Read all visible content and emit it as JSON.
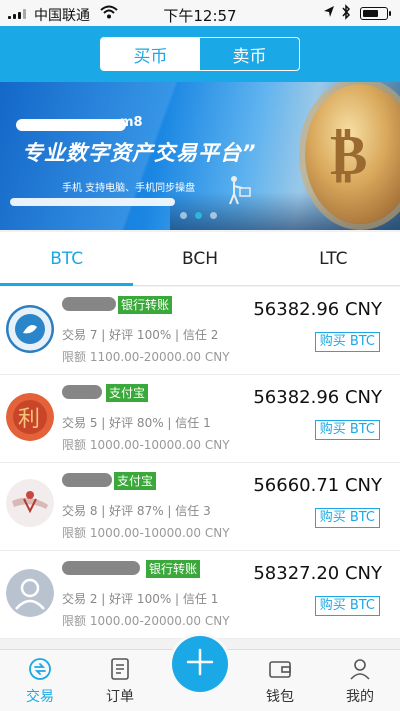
{
  "status_bar": {
    "carrier": "中国联通",
    "time": "下午12:57"
  },
  "header": {
    "segments": [
      "买币",
      "卖币"
    ],
    "active_segment": "买币"
  },
  "banner": {
    "brand_tail": "m8",
    "headline": "专业数字资产交易平台”",
    "subline": "手机  支持电脑、手机同步操盘"
  },
  "coin_tabs": [
    "BTC",
    "BCH",
    "LTC"
  ],
  "active_coin": "BTC",
  "listings": [
    {
      "payment": "银行转账",
      "stats": "交易 7 | 好评 100% | 信任 2",
      "limit": "限额 1100.00-20000.00 CNY",
      "price": "56382.96 CNY",
      "buy_label": "购买 BTC"
    },
    {
      "payment": "支付宝",
      "stats": "交易 5 | 好评 80% | 信任 1",
      "limit": "限额 1000.00-10000.00 CNY",
      "price": "56382.96 CNY",
      "buy_label": "购买 BTC"
    },
    {
      "payment": "支付宝",
      "stats": "交易 8 | 好评 87% | 信任 3",
      "limit": "限额 1000.00-10000.00 CNY",
      "price": "56660.71 CNY",
      "buy_label": "购买 BTC"
    },
    {
      "payment": "银行转账",
      "stats": "交易 2 | 好评 100% | 信任 1",
      "limit": "限额 1000.00-20000.00 CNY",
      "price": "58327.20 CNY",
      "buy_label": "购买 BTC"
    }
  ],
  "tab_bar": {
    "items": [
      {
        "label": "交易",
        "icon": "exchange-icon"
      },
      {
        "label": "订单",
        "icon": "order-icon"
      },
      {
        "label": "钱包",
        "icon": "wallet-icon"
      },
      {
        "label": "我的",
        "icon": "profile-icon"
      }
    ],
    "center_icon": "plus-icon",
    "active": "交易"
  },
  "colors": {
    "accent": "#1ba8e6",
    "badge_green": "#3aa83a"
  }
}
